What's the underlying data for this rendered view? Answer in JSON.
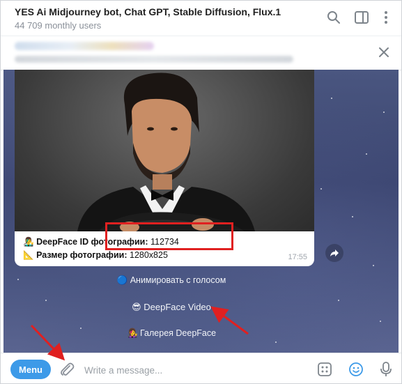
{
  "header": {
    "title": "YES Ai Midjourney bot, Chat GPT, Stable Diffusion, Flux.1",
    "subtitle": "44 709 monthly users"
  },
  "message": {
    "line1_label": "DeepFace ID фотографии:",
    "line1_value": "112734",
    "line2_label": "Размер фотографии:",
    "line2_value": "1280x825",
    "time": "17:55"
  },
  "keyboard": {
    "animate": "🔵 Анимировать с голосом",
    "video": "😎 DeepFace Video",
    "gallery": "👩‍🎤 Галерея DeepFace"
  },
  "composer": {
    "menu_label": "Menu",
    "placeholder": "Write a message..."
  },
  "colors": {
    "accent": "#3d9ae8",
    "highlight": "#e02020"
  }
}
